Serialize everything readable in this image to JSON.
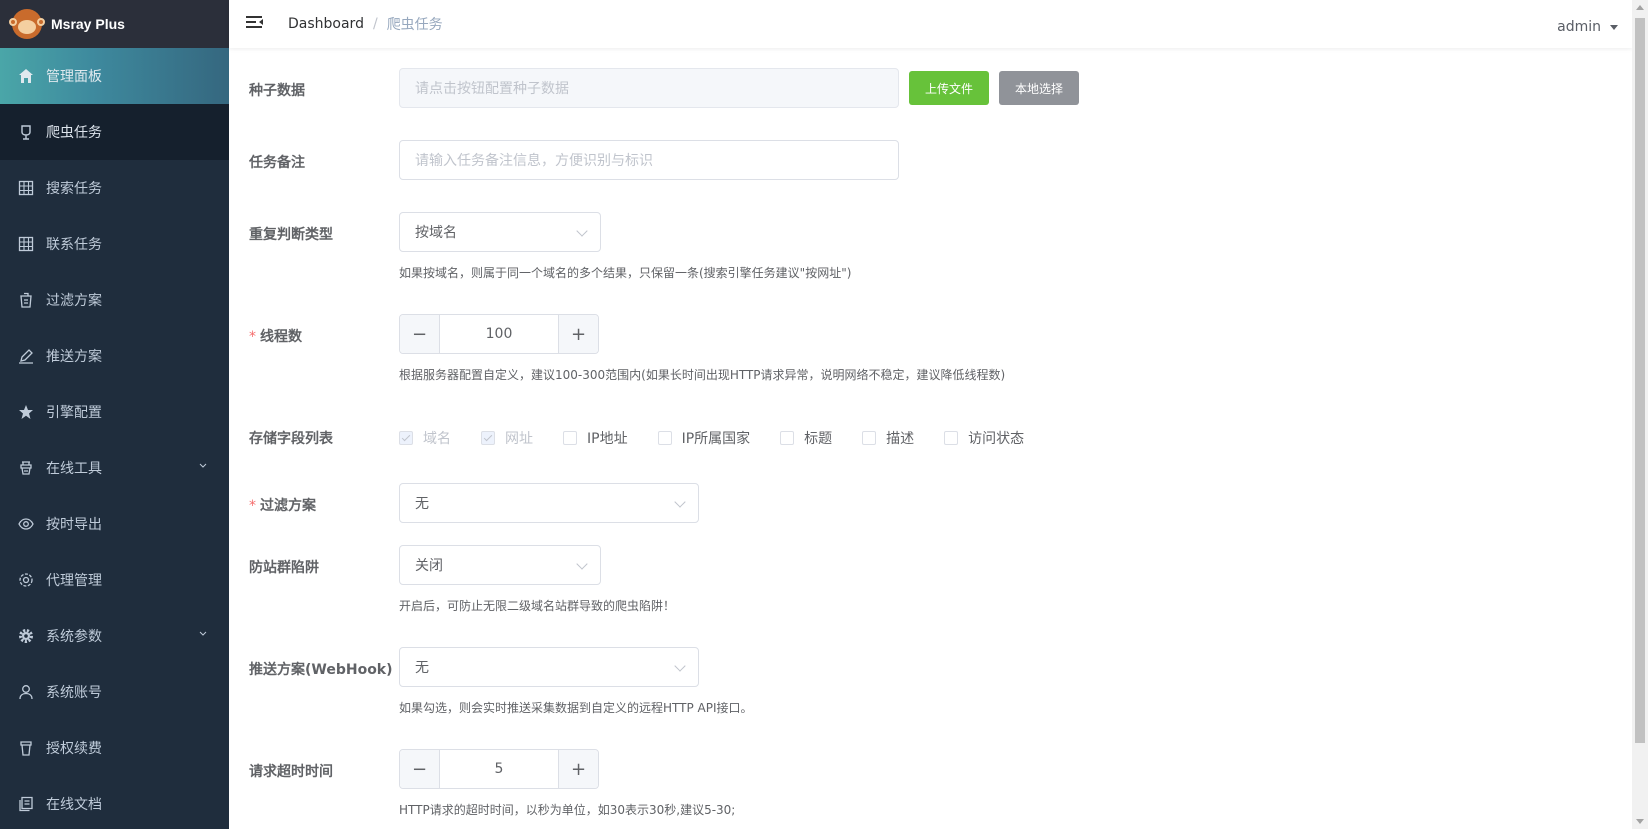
{
  "app": {
    "title": "Msray Plus"
  },
  "sidebar": {
    "items": [
      {
        "label": "管理面板",
        "icon": "home-icon"
      },
      {
        "label": "爬虫任务",
        "icon": "bug-icon"
      },
      {
        "label": "搜索任务",
        "icon": "table-icon"
      },
      {
        "label": "联系任务",
        "icon": "table-icon"
      },
      {
        "label": "过滤方案",
        "icon": "filter-icon"
      },
      {
        "label": "推送方案",
        "icon": "edit-icon"
      },
      {
        "label": "引擎配置",
        "icon": "star-icon"
      },
      {
        "label": "在线工具",
        "icon": "tool-icon"
      },
      {
        "label": "按时导出",
        "icon": "eye-icon"
      },
      {
        "label": "代理管理",
        "icon": "settings-icon"
      },
      {
        "label": "系统参数",
        "icon": "gear-icon"
      },
      {
        "label": "系统账号",
        "icon": "user-icon"
      },
      {
        "label": "授权续费",
        "icon": "cup-icon"
      },
      {
        "label": "在线文档",
        "icon": "document-icon"
      }
    ]
  },
  "header": {
    "breadcrumb": {
      "home": "Dashboard",
      "separator": "/",
      "current": "爬虫任务"
    },
    "user": "admin"
  },
  "form": {
    "seed": {
      "label": "种子数据",
      "placeholder": "请点击按钮配置种子数据",
      "upload_label": "上传文件",
      "local_label": "本地选择"
    },
    "remark": {
      "label": "任务备注",
      "placeholder": "请输入任务备注信息，方便识别与标识"
    },
    "dedup": {
      "label": "重复判断类型",
      "value": "按域名",
      "hint": "如果按域名，则属于同一个域名的多个结果，只保留一条(搜索引擎任务建议\"按网址\")"
    },
    "threads": {
      "label": "线程数",
      "value": "100",
      "hint": "根据服务器配置自定义，建议100-300范围内(如果长时间出现HTTP请求异常，说明网络不稳定，建议降低线程数)"
    },
    "fields": {
      "label": "存储字段列表",
      "options": [
        {
          "label": "域名",
          "checked": true,
          "disabled": true
        },
        {
          "label": "网址",
          "checked": true,
          "disabled": true
        },
        {
          "label": "IP地址",
          "checked": false,
          "disabled": false
        },
        {
          "label": "IP所属国家",
          "checked": false,
          "disabled": false
        },
        {
          "label": "标题",
          "checked": false,
          "disabled": false
        },
        {
          "label": "描述",
          "checked": false,
          "disabled": false
        },
        {
          "label": "访问状态",
          "checked": false,
          "disabled": false
        }
      ]
    },
    "filter": {
      "label": "过滤方案",
      "value": "无"
    },
    "trap": {
      "label": "防站群陷阱",
      "value": "关闭",
      "hint": "开启后，可防止无限二级域名站群导致的爬虫陷阱！"
    },
    "webhook": {
      "label": "推送方案(WebHook)",
      "value": "无",
      "hint": "如果勾选，则会实时推送采集数据到自定义的远程HTTP API接口。"
    },
    "timeout": {
      "label": "请求超时时间",
      "value": "5",
      "hint": "HTTP请求的超时时间，以秒为单位，如30表示30秒,建议5-30;"
    },
    "required_mark": "*"
  }
}
